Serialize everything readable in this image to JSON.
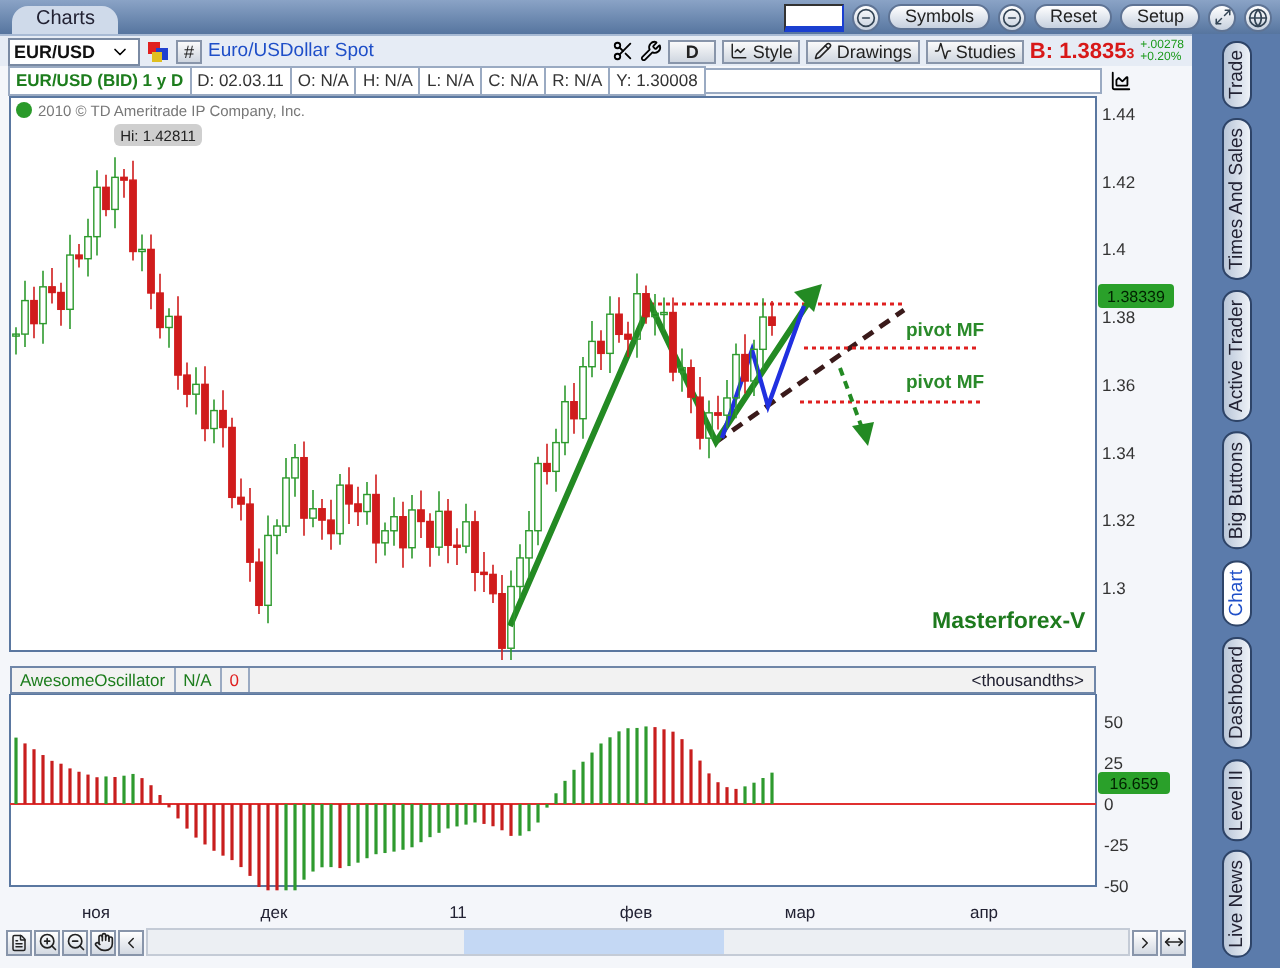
{
  "window": {
    "tab": "Charts",
    "buttons": [
      "Symbols",
      "Reset",
      "Setup"
    ]
  },
  "toolbar": {
    "symbol": "EUR/USD",
    "hash_button": "#",
    "description": "Euro/USDollar Spot",
    "period": "D",
    "buttons": [
      "Style",
      "Drawings",
      "Studies"
    ],
    "bid": "B: 1.3835$_{3}$",
    "change": "+.00278",
    "change_percent": "+0.20%"
  },
  "info_bar": {
    "title": "EUR/USD (BID) 1 y D",
    "cells": [
      "D: 02.03.11",
      "O: N/A",
      "H: N/A",
      "L: N/A",
      "C: N/A",
      "R: N/A",
      "Y: 1.30008"
    ]
  },
  "price_chart": {
    "copyright": "2010 © TD Ameritrade IP Company, Inc.",
    "high_label": "Hi: 1.42811",
    "yticks": [
      "1.44",
      "1.42",
      "1.4",
      "1.38",
      "1.36",
      "1.34",
      "1.32",
      "1.3"
    ],
    "last_price": "1.38339",
    "pivot_labels": [
      "pivot MF",
      "pivot MF"
    ],
    "caption": "Masterforex-V"
  },
  "oscillator": {
    "name": "AwesomeOscillator",
    "value": "N/A",
    "change": "0",
    "units": "<thousandths>",
    "yticks": [
      "50",
      "25",
      "0",
      "-25",
      "-50"
    ],
    "last_value": "16.659"
  },
  "x_axis": [
    "ноя",
    "дек",
    "11",
    "фев",
    "мар",
    "апр"
  ],
  "sidebar": {
    "tabs": [
      {
        "label": "Trade",
        "selected": false
      },
      {
        "label": "Times And Sales",
        "selected": false
      },
      {
        "label": "Active Trader",
        "selected": false
      },
      {
        "label": "Big Buttons",
        "selected": false
      },
      {
        "label": "Chart",
        "selected": true
      },
      {
        "label": "Dashboard",
        "selected": false
      },
      {
        "label": "Level II",
        "selected": false
      },
      {
        "label": "Live News",
        "selected": false
      }
    ]
  }
}
